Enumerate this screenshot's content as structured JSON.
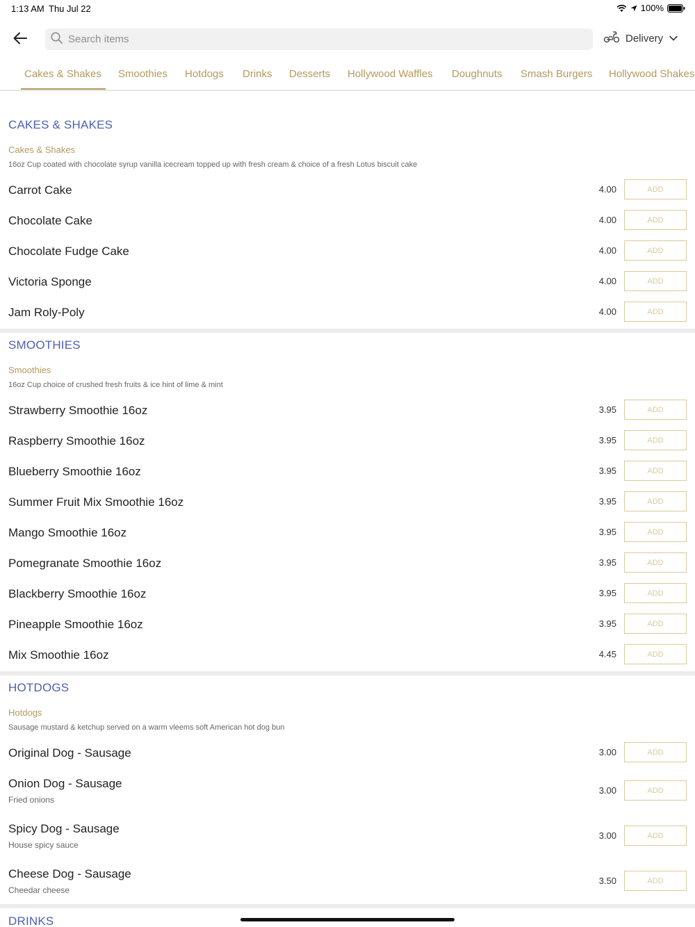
{
  "status_bar": {
    "time": "1:13 AM",
    "date": "Thu Jul 22",
    "battery": "100%"
  },
  "header": {
    "search_placeholder": "Search items",
    "delivery_label": "Delivery"
  },
  "tabs": [
    {
      "label": "Cakes & Shakes",
      "active": true
    },
    {
      "label": "Smoothies"
    },
    {
      "label": "Hotdogs"
    },
    {
      "label": "Drinks"
    },
    {
      "label": "Desserts"
    },
    {
      "label": "Hollywood Waffles"
    },
    {
      "label": "Doughnuts"
    },
    {
      "label": "Smash Burgers"
    },
    {
      "label": "Hollywood Shakes"
    }
  ],
  "add_label": "ADD",
  "sections": [
    {
      "title": "CAKES & SHAKES",
      "subtitle": "Cakes & Shakes",
      "description": "16oz Cup coated with chocolate syrup vanilla icecream topped up with fresh cream & choice of a fresh Lotus biscuit cake",
      "items": [
        {
          "name": "Carrot Cake",
          "price": "4.00"
        },
        {
          "name": "Chocolate Cake",
          "price": "4.00"
        },
        {
          "name": "Chocolate Fudge Cake",
          "price": "4.00"
        },
        {
          "name": "Victoria Sponge",
          "price": "4.00"
        },
        {
          "name": "Jam Roly-Poly",
          "price": "4.00"
        }
      ]
    },
    {
      "title": "SMOOTHIES",
      "subtitle": "Smoothies",
      "description": "16oz Cup choice of crushed fresh fruits & ice hint of lime & mint",
      "items": [
        {
          "name": "Strawberry Smoothie 16oz",
          "price": "3.95"
        },
        {
          "name": "Raspberry Smoothie 16oz",
          "price": "3.95"
        },
        {
          "name": "Blueberry Smoothie 16oz",
          "price": "3.95"
        },
        {
          "name": "Summer Fruit Mix Smoothie 16oz",
          "price": "3.95"
        },
        {
          "name": "Mango Smoothie 16oz",
          "price": "3.95"
        },
        {
          "name": "Pomegranate Smoothie 16oz",
          "price": "3.95"
        },
        {
          "name": "Blackberry Smoothie 16oz",
          "price": "3.95"
        },
        {
          "name": "Pineapple Smoothie 16oz",
          "price": "3.95"
        },
        {
          "name": "Mix Smoothie 16oz",
          "price": "4.45"
        }
      ]
    },
    {
      "title": "HOTDOGS",
      "subtitle": "Hotdogs",
      "description": "Sausage mustard & ketchup served on a warm vleems soft American hot dog bun",
      "items": [
        {
          "name": "Original Dog - Sausage",
          "price": "3.00"
        },
        {
          "name": "Onion Dog - Sausage",
          "price": "3.00",
          "note": "Fried onions"
        },
        {
          "name": "Spicy Dog - Sausage",
          "price": "3.00",
          "note": "House spicy sauce"
        },
        {
          "name": "Cheese Dog - Sausage",
          "price": "3.50",
          "note": "Cheedar cheese"
        }
      ]
    },
    {
      "title": "DRINKS"
    }
  ]
}
